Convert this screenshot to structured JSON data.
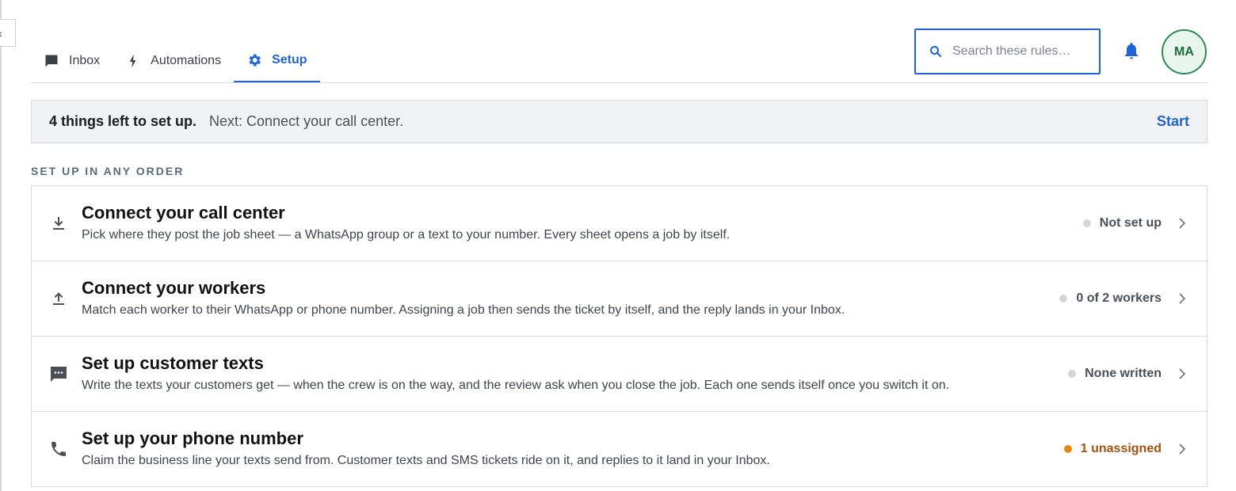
{
  "sidebar": {
    "collapse_glyph": "‹",
    "collapse_icon": "chevron-left-icon"
  },
  "tabs": [
    {
      "label": "Inbox",
      "icon": "chat-bubble-icon",
      "active": false
    },
    {
      "label": "Automations",
      "icon": "lightning-icon",
      "active": true
    },
    {
      "label": "Setup",
      "icon": "gear-icon",
      "active": true
    }
  ],
  "search": {
    "placeholder": "Search these rules…",
    "value": "",
    "icon": "search-icon"
  },
  "header": {
    "notifications_icon": "bell-icon",
    "avatar_initials": "MA"
  },
  "banner": {
    "count_text": "4 things left to set up.",
    "next_text": "Next: Connect your call center.",
    "action_label": "Start"
  },
  "section": {
    "label": "SET UP IN ANY ORDER"
  },
  "items": [
    {
      "icon": "download-icon",
      "title": "Connect your call center",
      "description": "Pick where they post the job sheet — a WhatsApp group or a text to your number. Every sheet opens a job by itself.",
      "status": "Not set up",
      "status_kind": "neutral"
    },
    {
      "icon": "upload-icon",
      "title": "Connect your workers",
      "description": "Match each worker to their WhatsApp or phone number. Assigning a job then sends the ticket by itself, and the reply lands in your Inbox.",
      "status": "0 of 2 workers",
      "status_kind": "neutral"
    },
    {
      "icon": "message-dots-icon",
      "title": "Set up customer texts",
      "description": "Write the texts your customers get — when the crew is on the way, and the review ask when you close the job. Each one sends itself once you switch it on.",
      "status": "None written",
      "status_kind": "neutral"
    },
    {
      "icon": "phone-icon",
      "title": "Set up your phone number",
      "description": "Claim the business line your texts send from. Customer texts and SMS tickets ride on it, and replies to it land in your Inbox.",
      "status": "1 unassigned",
      "status_kind": "warning"
    }
  ],
  "colors": {
    "accent": "#1f63d6",
    "warning": "#e8850f",
    "warning_text": "#a6520f",
    "avatar_border": "#2e8b4f",
    "neutral_dot": "#d4d6d9"
  }
}
